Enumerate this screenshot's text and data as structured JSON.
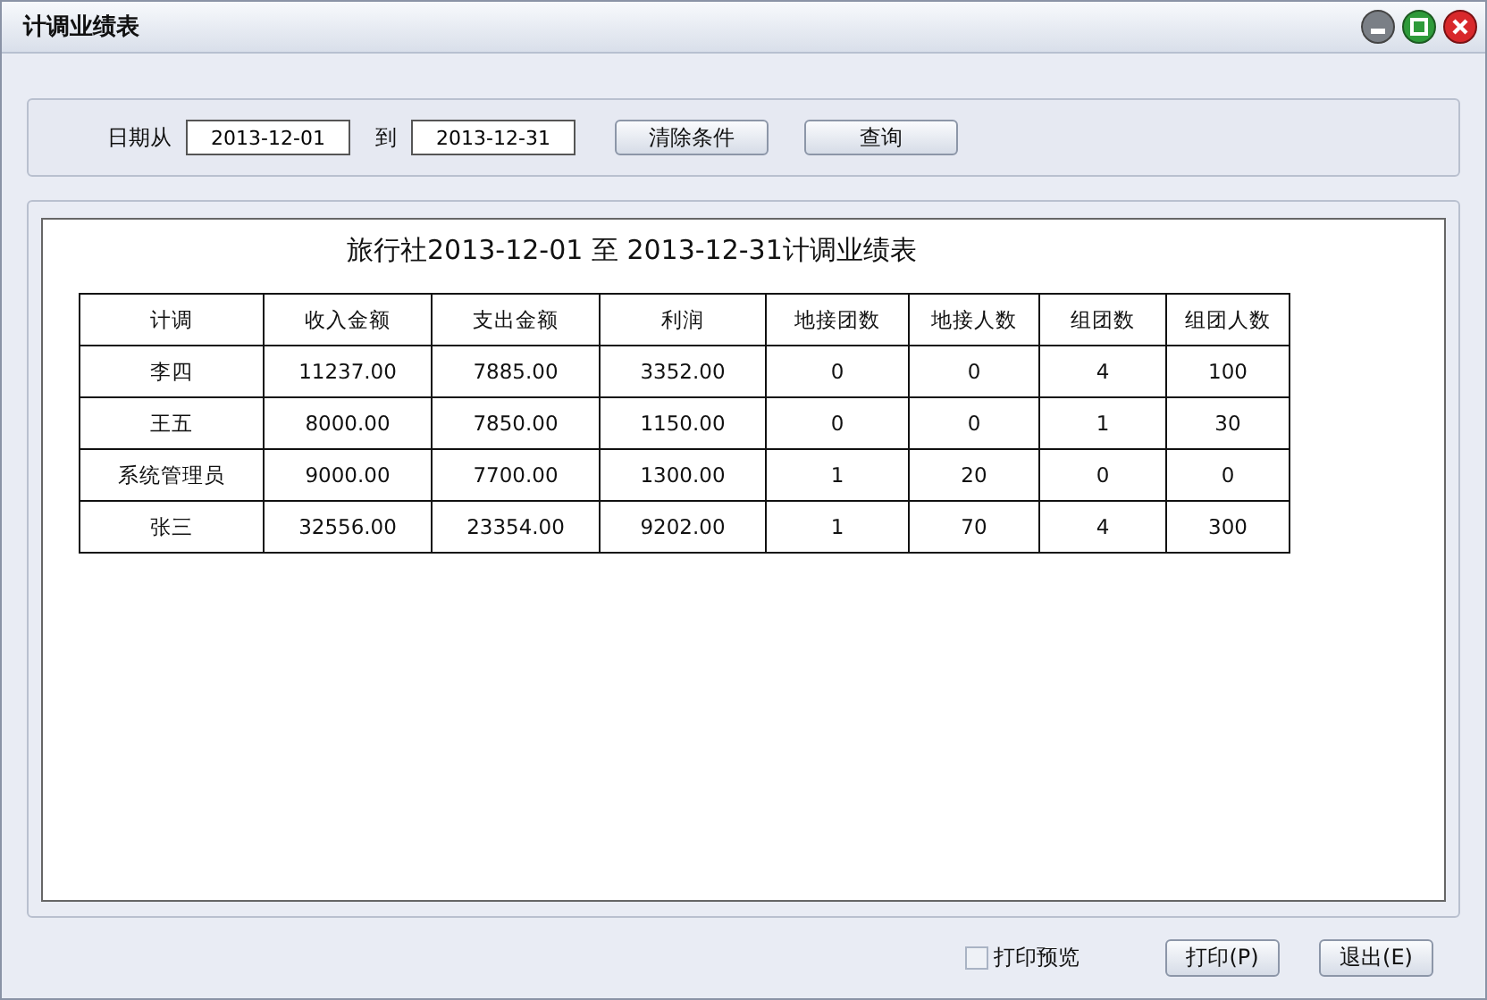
{
  "window": {
    "title": "计调业绩表"
  },
  "filter": {
    "from_label": "日期从",
    "from_value": "2013-12-01",
    "to_label": "到",
    "to_value": "2013-12-31",
    "buttons": [
      "清除条件",
      "查询"
    ]
  },
  "report": {
    "title": "旅行社2013-12-01 至 2013-12-31计调业绩表",
    "columns": [
      "计调",
      "收入金额",
      "支出金额",
      "利润",
      "地接团数",
      "地接人数",
      "组团数",
      "组团人数"
    ],
    "rows": [
      [
        "李四",
        "11237.00",
        "7885.00",
        "3352.00",
        "0",
        "0",
        "4",
        "100"
      ],
      [
        "王五",
        "8000.00",
        "7850.00",
        "1150.00",
        "0",
        "0",
        "1",
        "30"
      ],
      [
        "系统管理员",
        "9000.00",
        "7700.00",
        "1300.00",
        "1",
        "20",
        "0",
        "0"
      ],
      [
        "张三",
        "32556.00",
        "23354.00",
        "9202.00",
        "1",
        "70",
        "4",
        "300"
      ]
    ]
  },
  "footer": {
    "preview": {
      "label": "打印预览",
      "checked": false
    },
    "buttons": [
      "打印(P)",
      "退出(E)"
    ]
  }
}
